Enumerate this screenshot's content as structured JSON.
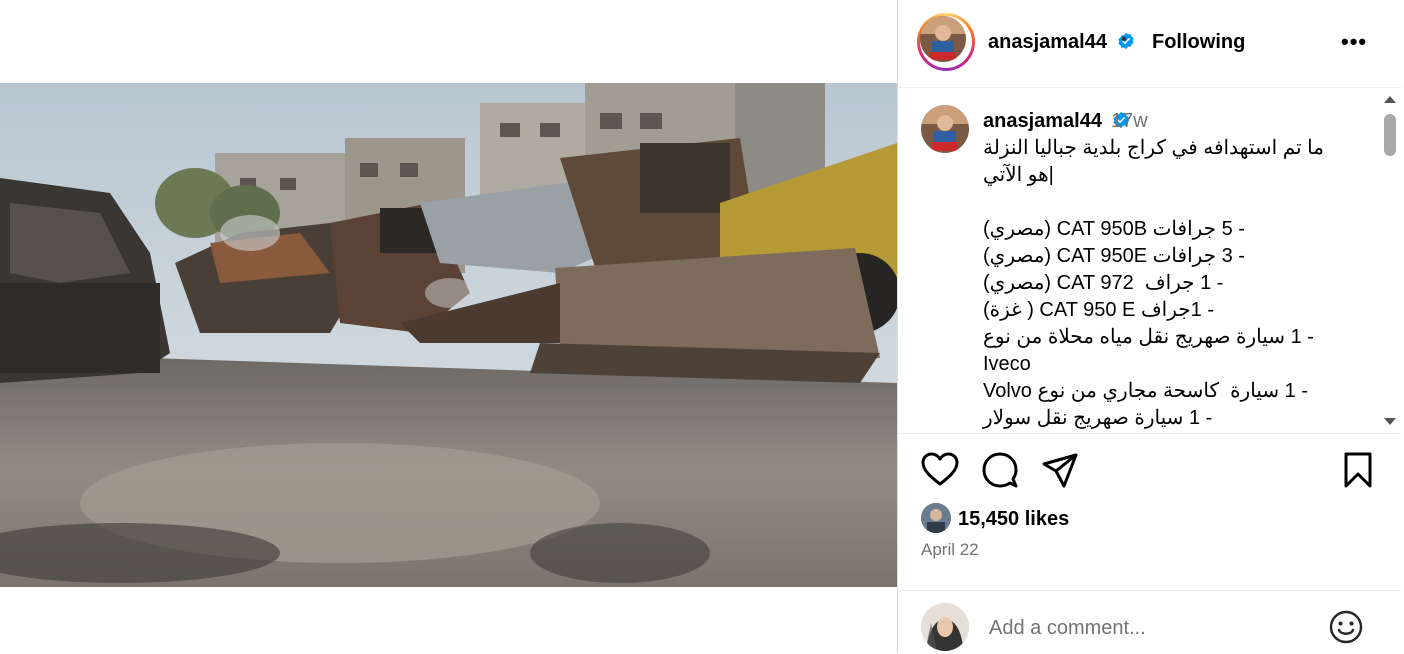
{
  "post": {
    "username": "anasjamal44",
    "follow_status": "Following",
    "time_ago": "17w",
    "caption_lines": [
      "ما تم استهدافه في كراج بلدية جباليا النزلة",
      "|هو الآتي",
      "",
      "- 5 جرافات CAT 950B (مصري)",
      "- 3 جرافات CAT 950E (مصري)",
      "- 1 جراف  CAT 972 (مصري)",
      "- 1جراف CAT 950 E ( غزة)",
      "- 1 سيارة صهريج نقل مياه محلاة من نوع",
      "Iveco",
      "- 1 سيارة  كاسحة مجاري من نوع Volvo",
      "- 1 سيارة صهريج نقل سولار"
    ],
    "likes": "15,450 likes",
    "date": "April 22",
    "comment_placeholder": "Add a comment..."
  },
  "header": {
    "more_label": "•••",
    "separator": "•"
  },
  "icons": {
    "like": "heart-icon",
    "comment": "comment-icon",
    "share": "send-icon",
    "save": "bookmark-icon",
    "emoji": "emoji-icon",
    "verified": "verified-badge-icon"
  },
  "colors": {
    "verified": "#0095f6",
    "muted": "#737373",
    "divider": "#dbdbdb"
  }
}
